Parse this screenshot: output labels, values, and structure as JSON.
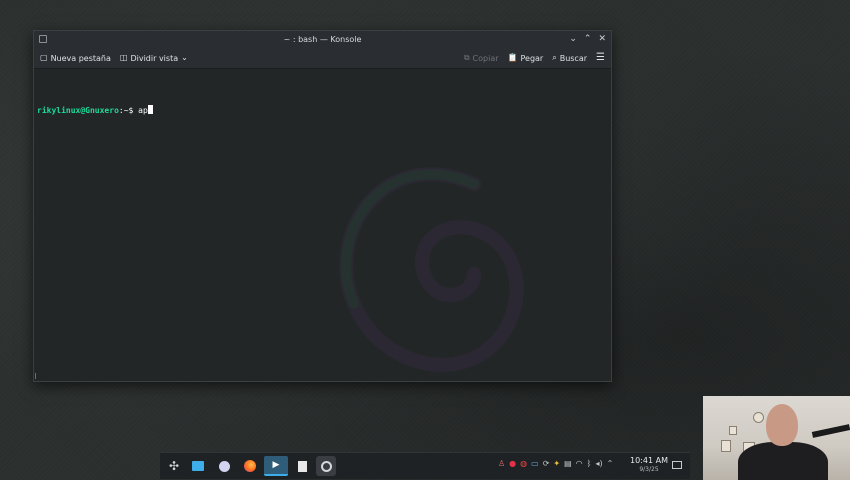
{
  "window": {
    "title": "~ : bash — Konsole",
    "controls": [
      "chevron-down-icon",
      "chevron-up-icon",
      "close-icon"
    ]
  },
  "toolbar": {
    "new_tab_label": "Nueva pestaña",
    "split_view_label": "Dividir vista",
    "copy_label": "Copiar",
    "paste_label": "Pegar",
    "search_label": "Buscar"
  },
  "terminal": {
    "user_host": "rikylinux@Gnuxero",
    "path_prompt": ":~$ ",
    "typed_text": "ap"
  },
  "taskbar": {
    "apps": [
      "app-launcher-icon",
      "file-manager-icon",
      "plasma-discover-icon",
      "firefox-icon",
      "konsole-icon",
      "text-editor-icon",
      "obs-icon"
    ],
    "active_app": "konsole-icon"
  },
  "clock": {
    "time": "10:41 AM",
    "date": "9/3/25"
  },
  "colors": {
    "prompt_user": "#1cdc9a",
    "terminal_bg": "#232627",
    "active_task": "#3daee9"
  }
}
